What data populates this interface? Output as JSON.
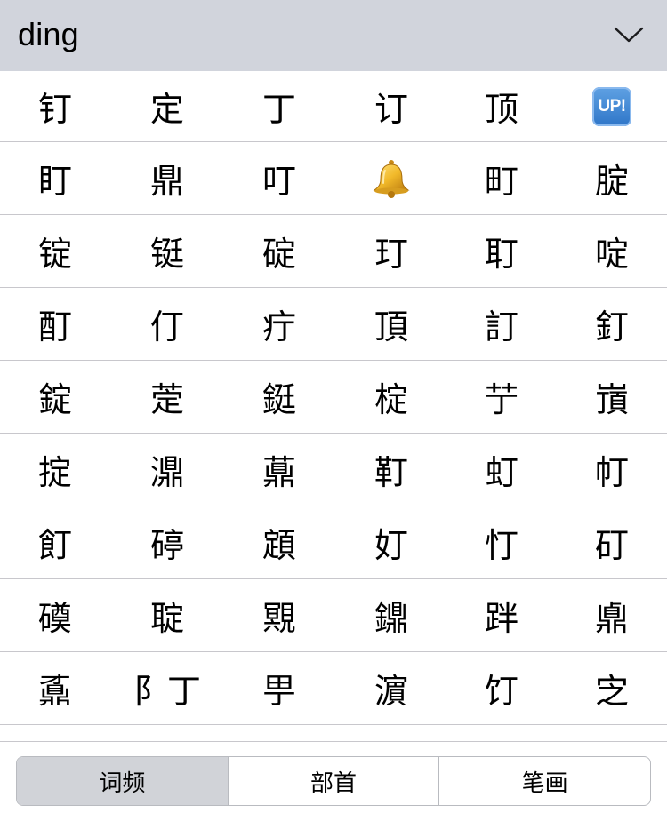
{
  "header": {
    "pinyin": "ding",
    "collapse_icon": "chevron-down-icon"
  },
  "candidates": [
    [
      "钉",
      "定",
      "丁",
      "订",
      "顶",
      {
        "emoji": "up-button",
        "label": "UP!"
      }
    ],
    [
      "盯",
      "鼎",
      "叮",
      {
        "emoji": "bell-icon"
      },
      "町",
      "腚"
    ],
    [
      "锭",
      "铤",
      "碇",
      "玎",
      "耵",
      "啶"
    ],
    [
      "酊",
      "仃",
      "疔",
      "頂",
      "訂",
      "釘"
    ],
    [
      "錠",
      "萣",
      "鋌",
      "椗",
      "艼",
      "嵿"
    ],
    [
      "掟",
      "濎",
      "薡",
      "靪",
      "虰",
      "帄"
    ],
    [
      "飣",
      "碠",
      "顁",
      "奵",
      "忊",
      "矴"
    ],
    [
      "磸",
      "聢",
      "覭",
      "鐤",
      "跘",
      "鼑"
    ],
    [
      "鼒",
      "阝丁",
      "甼",
      "濵",
      "饤",
      "㝎"
    ]
  ],
  "sort_tabs": [
    {
      "label": "词频",
      "selected": true
    },
    {
      "label": "部首",
      "selected": false
    },
    {
      "label": "笔画",
      "selected": false
    }
  ],
  "colors": {
    "header_bg": "#d1d4dc",
    "divider": "#c8c7cc",
    "selected_tab_bg": "#d1d3d8"
  }
}
